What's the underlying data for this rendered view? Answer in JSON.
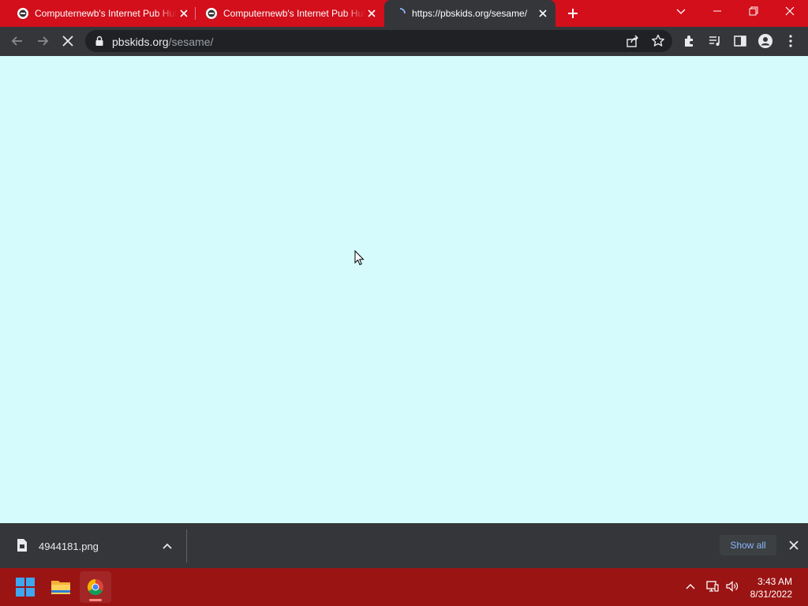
{
  "browser": {
    "tabs": [
      {
        "title": "Computernewb's Internet Pub Hub",
        "favicon": "computernewb-favicon",
        "active": false
      },
      {
        "title": "Computernewb's Internet Pub Hub",
        "favicon": "computernewb-favicon",
        "active": false
      },
      {
        "title": "https://pbskids.org/sesame/",
        "favicon": "loading-spinner-icon",
        "active": true
      }
    ],
    "address_bar": {
      "domain": "pbskids.org",
      "path": "/sesame/"
    },
    "accent_color": "#d20f1b",
    "page_background": "#d6fbfd"
  },
  "download_shelf": {
    "item": {
      "filename": "4944181.png"
    },
    "show_all_label": "Show all"
  },
  "taskbar": {
    "apps": [
      "start-button",
      "file-explorer",
      "chrome"
    ],
    "clock": {
      "time": "3:43 AM",
      "date": "8/31/2022"
    }
  }
}
